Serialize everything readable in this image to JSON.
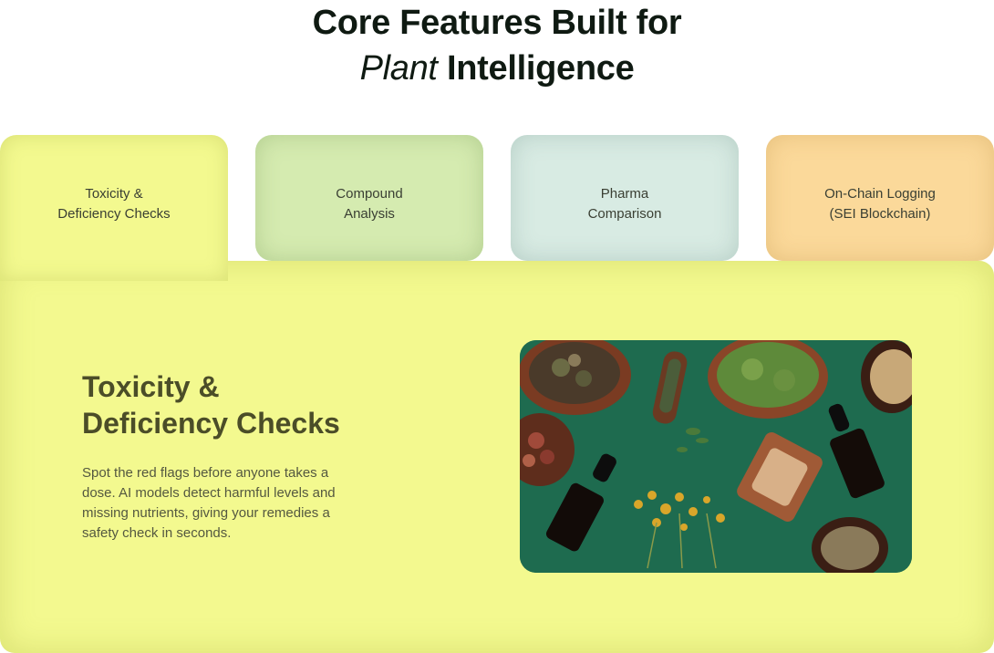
{
  "heading": {
    "line1": "Core Features Built for",
    "line2_italic": "Plant",
    "line2_rest": " Intelligence"
  },
  "tabs": [
    {
      "label": "Toxicity &\nDeficiency Checks",
      "active": true,
      "color": "#f3f98f"
    },
    {
      "label": "Compound\nAnalysis",
      "active": false,
      "color": "#d5ebb0"
    },
    {
      "label": "Pharma\nComparison",
      "active": false,
      "color": "#d8ebe3"
    },
    {
      "label": "On-Chain Logging\n(SEI Blockchain)",
      "active": false,
      "color": "#fbd99a"
    }
  ],
  "panel": {
    "title": "Toxicity &\nDeficiency Checks",
    "description": "Spot the red flags before anyone takes a dose. AI models detect harmful levels and missing nutrients, giving your remedies a safety check in seconds.",
    "image_subject": "herbs-and-tincture-bottles-photo"
  }
}
